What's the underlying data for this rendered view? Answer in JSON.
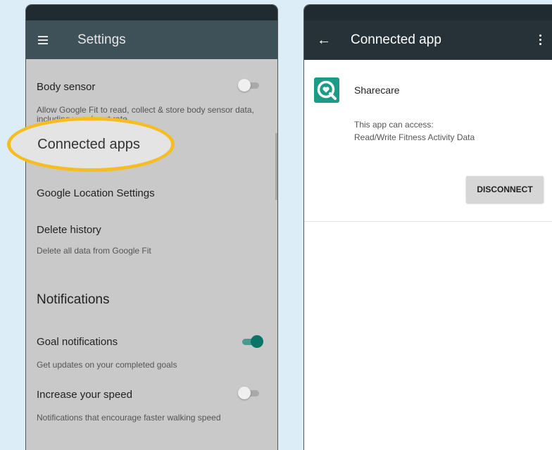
{
  "left_screen": {
    "title": "Settings",
    "icons": {
      "menu": "hamburger-menu-icon"
    },
    "rows": [
      {
        "title": "Body sensor",
        "subtitle": "Allow Google Fit to read, collect & store body sensor data, including your heart rate.",
        "toggle": "off"
      },
      {
        "title": "Google Location Settings"
      },
      {
        "title": "Delete history",
        "subtitle": "Delete all data from Google Fit"
      }
    ],
    "highlight_label": "Connected apps",
    "notifications": {
      "heading": "Notifications",
      "rows": [
        {
          "title": "Goal notifications",
          "subtitle": "Get updates on your completed goals",
          "toggle": "on"
        },
        {
          "title": "Increase your speed",
          "subtitle": "Notifications that encourage faster walking speed",
          "toggle": "off"
        }
      ]
    },
    "colors": {
      "appbar": "#3e5159",
      "highlight_ring": "#f5bd22",
      "toggle_on": "#0a7466"
    }
  },
  "right_screen": {
    "title": "Connected app",
    "icons": {
      "back": "back-arrow-icon",
      "overflow": "more-vert-icon",
      "app": "sharecare-logo-icon"
    },
    "app_name": "Sharecare",
    "access_label": "This app can access:",
    "access_value": "Read/Write Fitness Activity Data",
    "disconnect_label": "DISCONNECT",
    "colors": {
      "appbar": "#263238",
      "app_icon": "#1c9b86"
    }
  }
}
